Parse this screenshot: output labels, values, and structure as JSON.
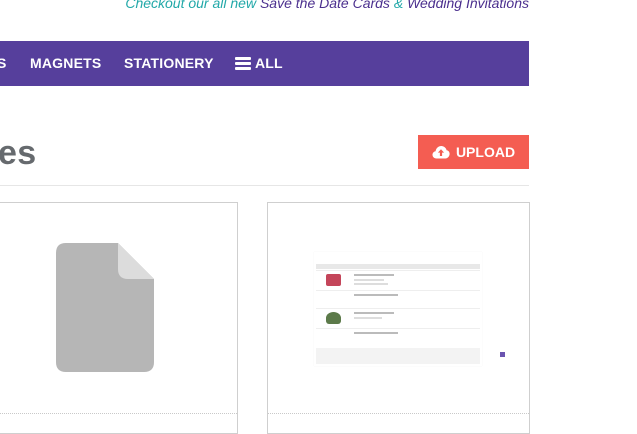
{
  "promo": {
    "lead": "Checkout our all new",
    "item1": "Save the Date Cards",
    "amp": "&",
    "item2": "Wedding Invitations"
  },
  "nav": {
    "items": [
      {
        "label": "S"
      },
      {
        "label": "MAGNETS"
      },
      {
        "label": "STATIONERY"
      }
    ],
    "all_label": "ALL",
    "all_icon": "hamburger-menu-icon"
  },
  "page": {
    "title": "es"
  },
  "upload": {
    "label": "UPLOAD",
    "icon": "cloud-upload-icon"
  },
  "cards": [
    {
      "icon": "file-icon"
    },
    {
      "icon": "document-thumbnail"
    }
  ],
  "colors": {
    "nav_bg": "#563f9c",
    "upload_bg": "#f45d52",
    "promo_teal": "#21a8a8",
    "promo_purple": "#4b2f8e",
    "title": "#666a6e",
    "file_icon": "#b6b6b6"
  }
}
